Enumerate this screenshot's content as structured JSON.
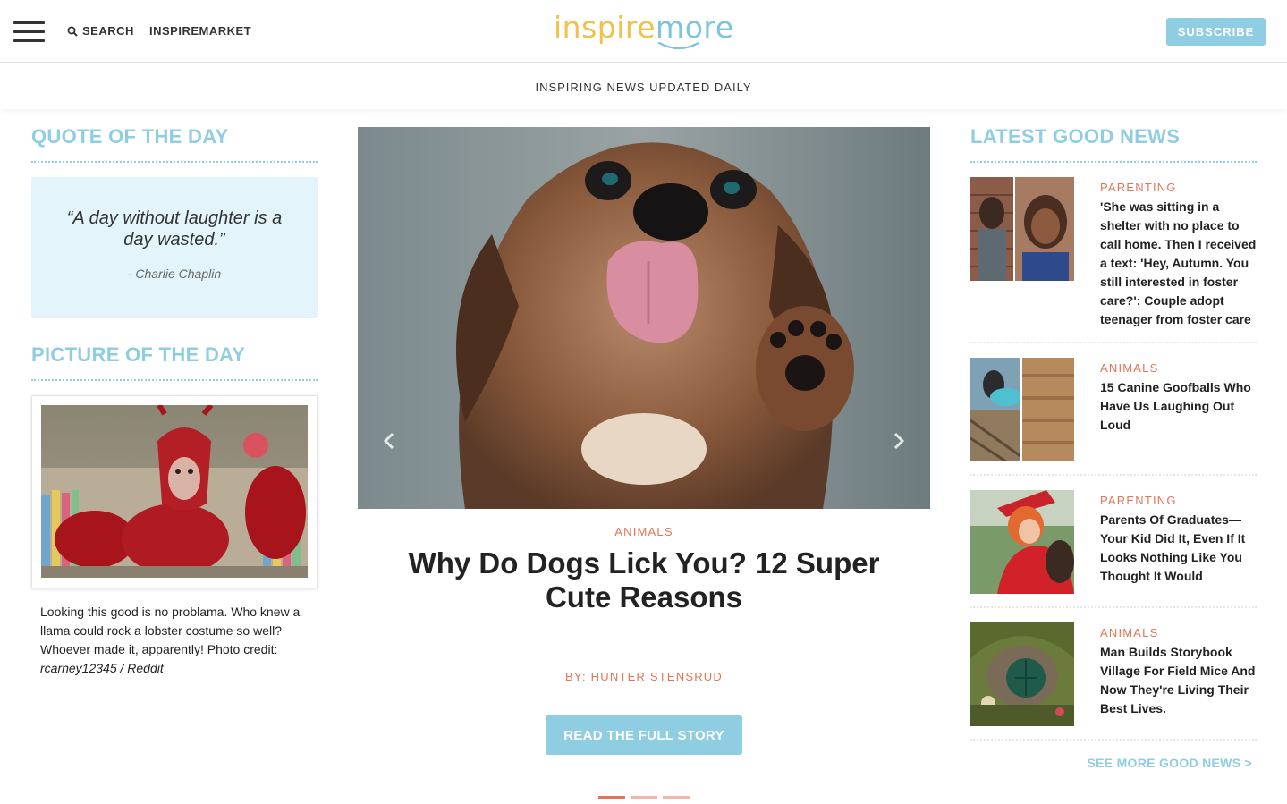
{
  "header": {
    "search_label": "SEARCH",
    "market_label": "INSPIREMARKET",
    "logo_part1": "inspire",
    "logo_part2": "more",
    "subscribe_label": "SUBSCRIBE",
    "tagline": "INSPIRING NEWS UPDATED DAILY"
  },
  "quote": {
    "section_title": "QUOTE OF THE DAY",
    "text": "“A day without laughter is a day wasted.”",
    "author": "- Charlie Chaplin"
  },
  "picture": {
    "section_title": "PICTURE OF THE DAY",
    "caption": "Looking this good is no problama. Who knew a llama could rock a lobster costume so well? Whoever made it, apparently! Photo credit:",
    "credit": "rcarney12345 / Reddit"
  },
  "featured": {
    "category": "ANIMALS",
    "headline": "Why Do Dogs Lick You? 12 Super Cute Reasons",
    "byline": "BY: HUNTER STENSRUD",
    "cta_label": "READ THE FULL STORY",
    "prev_icon": "chevron-left-icon",
    "next_icon": "chevron-right-icon",
    "slide_count": 3,
    "active_slide": 1
  },
  "latest": {
    "section_title": "LATEST GOOD NEWS",
    "items": [
      {
        "category": "PARENTING",
        "headline": "'She was sitting in a shelter with no place to call home. Then I received a text: 'Hey, Autumn. You still interested in foster care?': Couple adopt teenager from foster care"
      },
      {
        "category": "ANIMALS",
        "headline": "15 Canine Goofballs Who Have Us Laughing Out Loud"
      },
      {
        "category": "PARENTING",
        "headline": "Parents Of Graduates—Your Kid Did It, Even If It Looks Nothing Like You Thought It Would"
      },
      {
        "category": "ANIMALS",
        "headline": "Man Builds Storybook Village For Field Mice And Now They're Living Their Best Lives."
      }
    ],
    "see_more_label": "SEE MORE GOOD NEWS >"
  },
  "colors": {
    "accent_blue": "#8ecde2",
    "accent_orange": "#e47457",
    "logo_yellow": "#f1c24b",
    "quote_bg": "#e3f4fb"
  }
}
